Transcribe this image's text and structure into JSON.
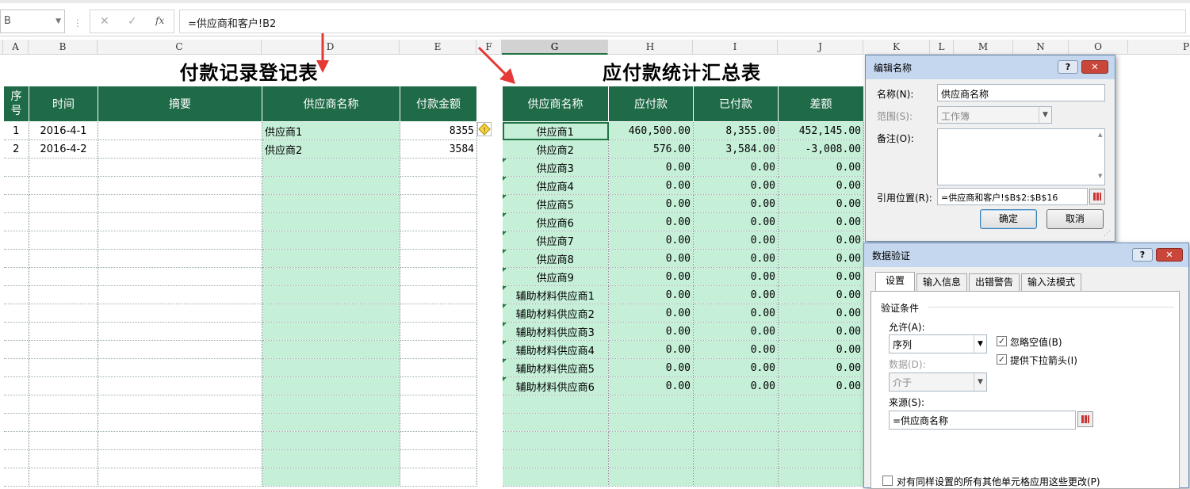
{
  "namebox": {
    "value": "B",
    "arrow": "chevron-down-icon"
  },
  "formula_bar": {
    "cancel": "✕",
    "confirm": "✓",
    "fx": "fx",
    "formula": "=供应商和客户!B2"
  },
  "columns": [
    "A",
    "B",
    "C",
    "D",
    "E",
    "F",
    "G",
    "H",
    "I",
    "J",
    "K",
    "L",
    "M",
    "N",
    "O",
    "P"
  ],
  "selected_column": "G",
  "left_table": {
    "title": "付款记录登记表",
    "headers": [
      "序\n号",
      "时间",
      "摘要",
      "供应商名称",
      "付款金额"
    ],
    "rows": [
      {
        "no": "1",
        "date": "2016-4-1",
        "summary": "",
        "vendor": "供应商1",
        "amount": "8355"
      },
      {
        "no": "2",
        "date": "2016-4-2",
        "summary": "",
        "vendor": "供应商2",
        "amount": "3584"
      }
    ],
    "empty_rows": 18
  },
  "right_table": {
    "title": "应付款统计汇总表",
    "headers": [
      "供应商名称",
      "应付款",
      "已付款",
      "差额"
    ],
    "rows": [
      [
        "供应商1",
        "460,500.00",
        "8,355.00",
        "452,145.00"
      ],
      [
        "供应商2",
        "576.00",
        "3,584.00",
        "-3,008.00"
      ],
      [
        "供应商3",
        "0.00",
        "0.00",
        "0.00"
      ],
      [
        "供应商4",
        "0.00",
        "0.00",
        "0.00"
      ],
      [
        "供应商5",
        "0.00",
        "0.00",
        "0.00"
      ],
      [
        "供应商6",
        "0.00",
        "0.00",
        "0.00"
      ],
      [
        "供应商7",
        "0.00",
        "0.00",
        "0.00"
      ],
      [
        "供应商8",
        "0.00",
        "0.00",
        "0.00"
      ],
      [
        "供应商9",
        "0.00",
        "0.00",
        "0.00"
      ],
      [
        "辅助材料供应商1",
        "0.00",
        "0.00",
        "0.00"
      ],
      [
        "辅助材料供应商2",
        "0.00",
        "0.00",
        "0.00"
      ],
      [
        "辅助材料供应商3",
        "0.00",
        "0.00",
        "0.00"
      ],
      [
        "辅助材料供应商4",
        "0.00",
        "0.00",
        "0.00"
      ],
      [
        "辅助材料供应商5",
        "0.00",
        "0.00",
        "0.00"
      ],
      [
        "辅助材料供应商6",
        "0.00",
        "0.00",
        "0.00"
      ]
    ],
    "empty_rows": 5
  },
  "edit_name_dialog": {
    "title": "编辑名称",
    "help": "?",
    "close": "✕",
    "name_label": "名称(N):",
    "name_value": "供应商名称",
    "scope_label": "范围(S):",
    "scope_value": "工作簿",
    "comment_label": "备注(O):",
    "comment_value": "",
    "ref_label": "引用位置(R):",
    "ref_value": "=供应商和客户!$B$2:$B$16",
    "ok": "确定",
    "cancel": "取消"
  },
  "validation_dialog": {
    "title": "数据验证",
    "help": "?",
    "close": "✕",
    "tabs": [
      "设置",
      "输入信息",
      "出错警告",
      "输入法模式"
    ],
    "section": "验证条件",
    "allow_label": "允许(A):",
    "allow_value": "序列",
    "ignore_blank": "忽略空值(B)",
    "dropdown": "提供下拉箭头(I)",
    "data_label": "数据(D):",
    "data_value": "介于",
    "source_label": "来源(S):",
    "source_value": "=供应商名称",
    "apply_all": "对有同样设置的所有其他单元格应用这些更改(P)"
  },
  "warning_icon": "warning-diamond-icon",
  "colors": {
    "header_green": "#1f6b47",
    "cell_green": "#c6efd8",
    "arrow_red": "#e53935",
    "dialog_title": "#c5d7ee"
  }
}
